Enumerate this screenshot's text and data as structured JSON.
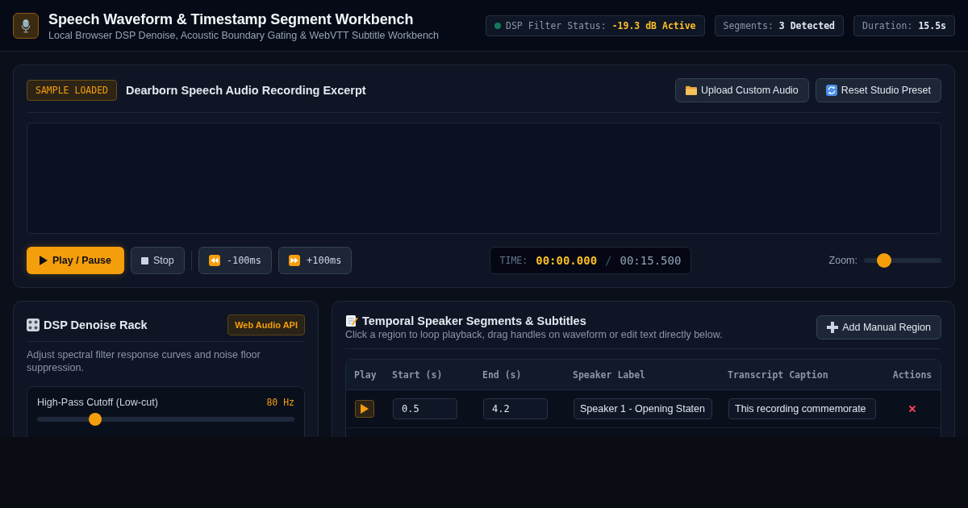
{
  "header": {
    "title": "Speech Waveform & Timestamp Segment Workbench",
    "subtitle": "Local Browser DSP Denoise, Acoustic Boundary Gating & WebVTT Subtitle Workbench",
    "pills": [
      {
        "kind": "status",
        "label": "DSP Filter Status:",
        "value": "-19.3 dB Active",
        "color": "#13795b"
      },
      {
        "kind": "count",
        "label": "Segments:",
        "value": "3 Detected"
      },
      {
        "kind": "count",
        "label": "Duration:",
        "value": "15.5s"
      }
    ]
  },
  "player": {
    "badge": "SAMPLE LOADED",
    "title": "Dearborn Speech Audio Recording Excerpt",
    "actions": [
      "Upload Custom Audio",
      "Reset Studio Preset"
    ],
    "transport": [
      {
        "kind": "primary",
        "label": "Play / Pause"
      },
      {
        "kind": "plain",
        "label": "Stop"
      },
      {
        "kind": "seek",
        "label": "-100ms"
      },
      {
        "kind": "seek",
        "label": "+100ms"
      }
    ],
    "time": {
      "label": "TIME:",
      "current": "00:00.000",
      "separator": "/",
      "total": "00:15.500"
    },
    "zoom": {
      "label": "Zoom:",
      "level": 0.2
    }
  },
  "dsp_rack": {
    "title": "DSP Denoise Rack",
    "badge": "Web Audio API",
    "description": "Adjust spectral filter response curves and noise floor suppression.",
    "sliders": [
      {
        "label": "High-Pass Cutoff (Low-cut)",
        "reading": "80 Hz",
        "level": 0.21
      }
    ]
  },
  "segments": {
    "title": "Temporal Speaker Segments & Subtitles",
    "subtitle": "Click a region to loop playback, drag handles on waveform or edit text directly below.",
    "add_button": "Add Manual Region",
    "table": {
      "columns": [
        "Play",
        "Start (s)",
        "End (s)",
        "Speaker Label",
        "Transcript Caption",
        "Actions"
      ],
      "rows": [
        {
          "start": "0.5",
          "end": "4.2",
          "speaker": "Speaker 1 - Opening Staten",
          "caption": "This recording commemorate"
        }
      ]
    }
  }
}
